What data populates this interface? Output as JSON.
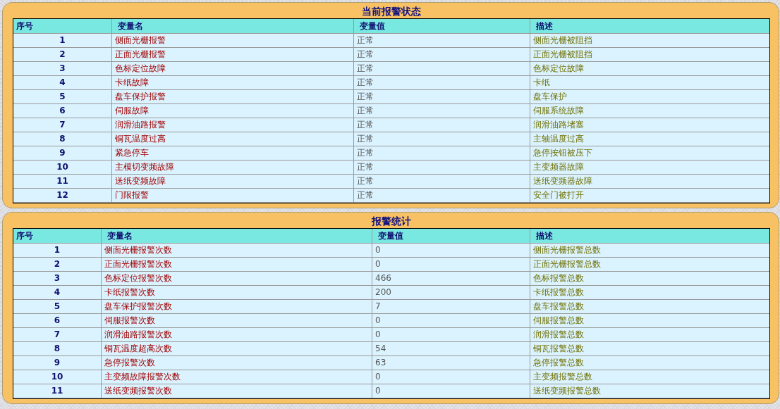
{
  "panels": [
    {
      "title": "当前报警状态",
      "columns": [
        "序号",
        "变量名",
        "变量值",
        "描述"
      ],
      "rows": [
        [
          "1",
          "侧面光栅报警",
          "正常",
          "侧面光栅被阻挡"
        ],
        [
          "2",
          "正面光栅报警",
          "正常",
          "正面光栅被阻挡"
        ],
        [
          "3",
          "色标定位故障",
          "正常",
          "色标定位故障"
        ],
        [
          "4",
          "卡纸故障",
          "正常",
          "卡纸"
        ],
        [
          "5",
          "盘车保护报警",
          "正常",
          "盘车保护"
        ],
        [
          "6",
          "伺服故障",
          "正常",
          "伺服系统故障"
        ],
        [
          "7",
          "润滑油路报警",
          "正常",
          "润滑油路堵塞"
        ],
        [
          "8",
          "铜瓦温度过高",
          "正常",
          "主轴温度过高"
        ],
        [
          "9",
          "紧急停车",
          "正常",
          "急停按钮被压下"
        ],
        [
          "10",
          "主模切变频故障",
          "正常",
          "主变频器故障"
        ],
        [
          "11",
          "送纸变频故障",
          "正常",
          "送纸变频器故障"
        ],
        [
          "12",
          "门限报警",
          "正常",
          "安全门被打开"
        ]
      ]
    },
    {
      "title": "报警统计",
      "columns": [
        "序号",
        "变量名",
        "变量值",
        "描述"
      ],
      "rows": [
        [
          "1",
          "侧面光栅报警次数",
          "0",
          "侧面光栅报警总数"
        ],
        [
          "2",
          "正面光栅报警次数",
          "0",
          "正面光栅报警总数"
        ],
        [
          "3",
          "色标定位报警次数",
          "466",
          "色标报警总数"
        ],
        [
          "4",
          "卡纸报警次数",
          "200",
          "卡纸报警总数"
        ],
        [
          "5",
          "盘车保护报警次数",
          "7",
          "盘车报警总数"
        ],
        [
          "6",
          "伺服报警次数",
          "0",
          "伺服报警总数"
        ],
        [
          "7",
          "润滑油路报警次数",
          "0",
          "润滑报警总数"
        ],
        [
          "8",
          "铜瓦温度超高次数",
          "54",
          "铜瓦报警总数"
        ],
        [
          "9",
          "急停报警次数",
          "63",
          "急停报警总数"
        ],
        [
          "10",
          "主变频故障报警次数",
          "0",
          "主变频报警总数"
        ],
        [
          "11",
          "送纸变频报警次数",
          "0",
          "送纸变频报警总数"
        ]
      ]
    }
  ]
}
